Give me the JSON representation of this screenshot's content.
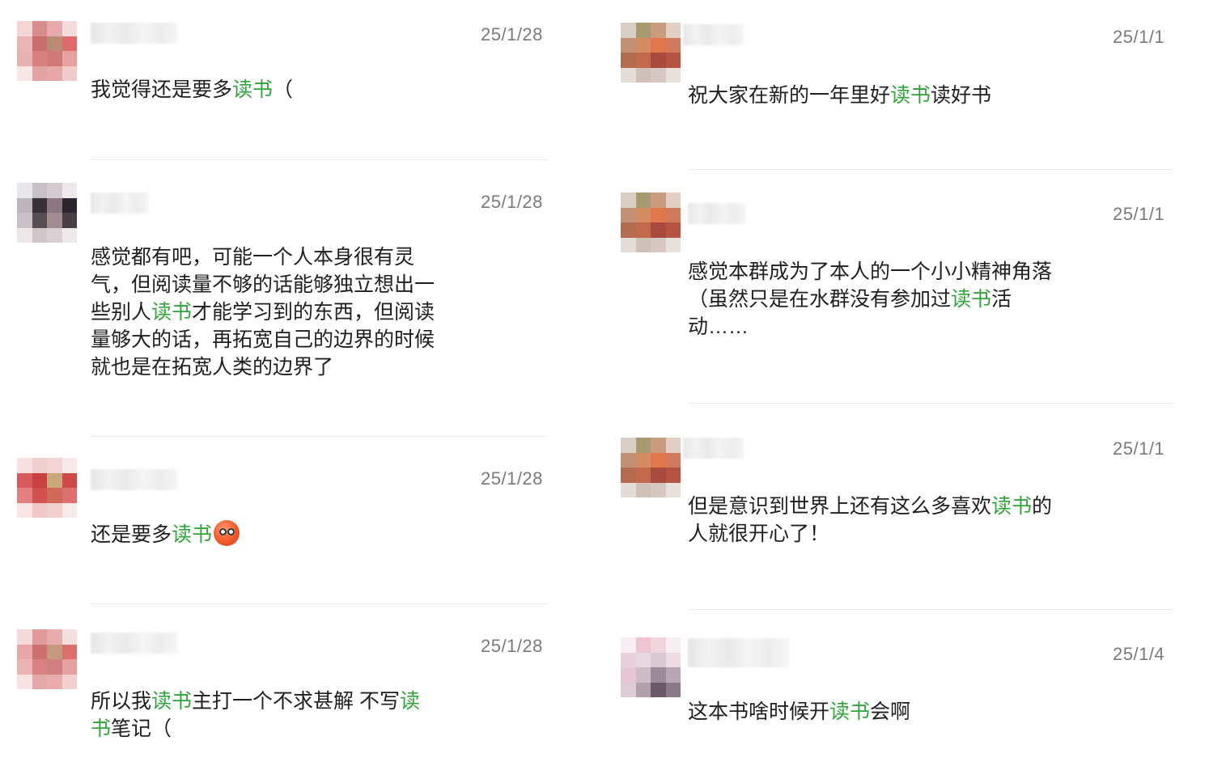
{
  "colors": {
    "highlight": "#2fa53a",
    "time": "#7a7a7a",
    "divider": "#ececec"
  },
  "left": [
    {
      "time": "25/1/28",
      "parts": [
        "我觉得还是要多",
        "读书",
        "（"
      ]
    },
    {
      "time": "25/1/28",
      "parts": [
        "感觉都有吧，可能一个人本身很有灵气，但阅读量不够的话能够独立想出一些别人",
        "读书",
        "才能学习到的东西，但阅读量够大的话，再拓宽自己的边界的时候就也是在拓宽人类的边界了"
      ]
    },
    {
      "time": "25/1/28",
      "parts": [
        "还是要多",
        "读书",
        ""
      ],
      "emoji": "worried-face-emoji"
    },
    {
      "time": "25/1/28",
      "parts": [
        "所以我",
        "读书",
        "主打一个不求甚解 不写",
        "读书",
        "笔记（"
      ]
    }
  ],
  "right": [
    {
      "time": "25/1/1",
      "parts": [
        "祝大家在新的一年里好",
        "读书",
        "读好书"
      ]
    },
    {
      "time": "25/1/1",
      "parts": [
        "感觉本群成为了本人的一个小小精神角落（虽然只是在水群没有参加过",
        "读书",
        "活动……"
      ]
    },
    {
      "time": "25/1/1",
      "parts": [
        "但是意识到世界上还有这么多喜欢",
        "读书",
        "的人就很开心了！"
      ]
    },
    {
      "time": "25/1/4",
      "parts": [
        "这本书啥时候开",
        "读书",
        "会啊"
      ]
    }
  ]
}
